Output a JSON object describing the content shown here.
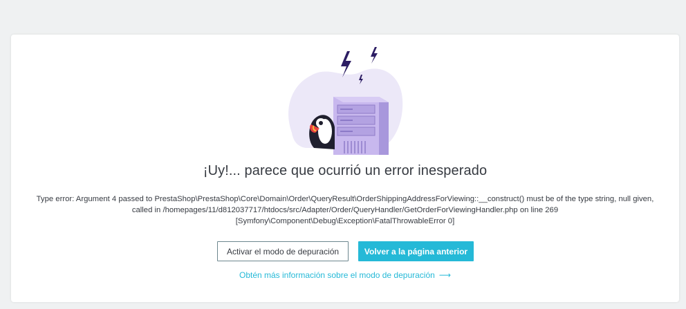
{
  "error": {
    "title": "¡Uy!... parece que ocurrió un error inesperado",
    "message_lines": [
      "Type error: Argument 4 passed to PrestaShop\\PrestaShop\\Core\\Domain\\Order\\QueryResult\\OrderShippingAddressForViewing::__construct() must be of the type string, null given,",
      "called in /homepages/11/d812037717/htdocs/src/Adapter/Order/QueryHandler/GetOrderForViewingHandler.php on line 269",
      "[Symfony\\Component\\Debug\\Exception\\FatalThrowableError 0]"
    ]
  },
  "actions": {
    "debug_label": "Activar el modo de depuración",
    "back_label": "Volver a la página anterior",
    "learn_more_label": "Obtén más información sobre el modo de depuración",
    "learn_more_arrow": "⟶"
  },
  "colors": {
    "background": "#eff1f2",
    "card": "#ffffff",
    "primary": "#25b9d7",
    "text": "#363a41",
    "illustration_purple": "#c8b8ee",
    "bolt": "#2c1d63"
  }
}
